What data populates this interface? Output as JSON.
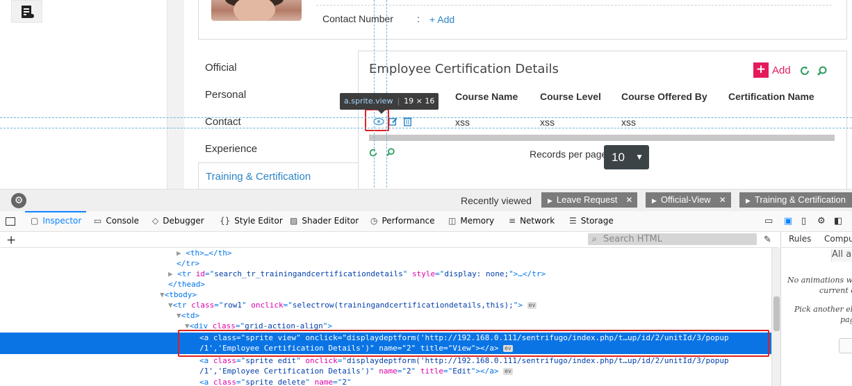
{
  "profile": {
    "contact_label": "Contact Number",
    "colon": ":",
    "add_label": "+ Add"
  },
  "tabs": [
    {
      "label": "Official"
    },
    {
      "label": "Personal"
    },
    {
      "label": "Contact"
    },
    {
      "label": "Experience"
    },
    {
      "label": "Training & Certification"
    }
  ],
  "certification": {
    "title": "Employee Certification Details",
    "add_label": "Add",
    "columns": [
      "Course Name",
      "Course Level",
      "Course Offered By",
      "Certification Name"
    ],
    "row": [
      "xss",
      "xss",
      "xss"
    ],
    "records_per_page_label": "Records per page",
    "records_per_page_value": "10"
  },
  "tooltip": {
    "selector": "a.sprite.view",
    "size": "19 × 16"
  },
  "recent": {
    "label": "Recently viewed",
    "items": [
      "Leave Request",
      "Official-View",
      "Training & Certification"
    ]
  },
  "devtools": {
    "tabs": [
      "Inspector",
      "Console",
      "Debugger",
      "Style Editor",
      "Shader Editor",
      "Performance",
      "Memory",
      "Network",
      "Storage"
    ],
    "search_placeholder": "Search HTML",
    "side_tabs": [
      "Rules",
      "Compu"
    ],
    "side_all": "All a",
    "side_msg1_a": "No animations w",
    "side_msg1_b": "current e",
    "side_msg2_a": "Pick another ele",
    "side_msg2_b": "pag",
    "code": {
      "l1": "<th>…</th>",
      "l2": "</tr>",
      "l3_id": "search_tr_trainingandcertificationdetails",
      "l3_style": "display: none;",
      "l4": "</thead>",
      "l5": "<tbody>",
      "l6_class": "row1",
      "l6_onclick": "selectrow(trainingandcertificationdetails,this);",
      "l7": "<td>",
      "l8_class": "grid-action-align",
      "sel_class": "sprite view",
      "sel_onclick": "displaydeptform('http://192.168.0.111/sentrifugo/index.php/t…up/id/2/unitId/3/popup",
      "sel_onclick2": "/1','Employee Certification Details')",
      "sel_name": "2",
      "sel_title": "View",
      "e_class": "sprite edit",
      "e_onclick": "displaydeptform('http://192.168.0.111/sentrifugo/index.php/t…up/id/2/unitId/3/popup",
      "e_onclick2": "/1','Employee Certification Details')",
      "e_name": "2",
      "e_title": "Edit",
      "d_class": "sprite delete",
      "d_name": "2",
      "ev": "ev"
    }
  }
}
